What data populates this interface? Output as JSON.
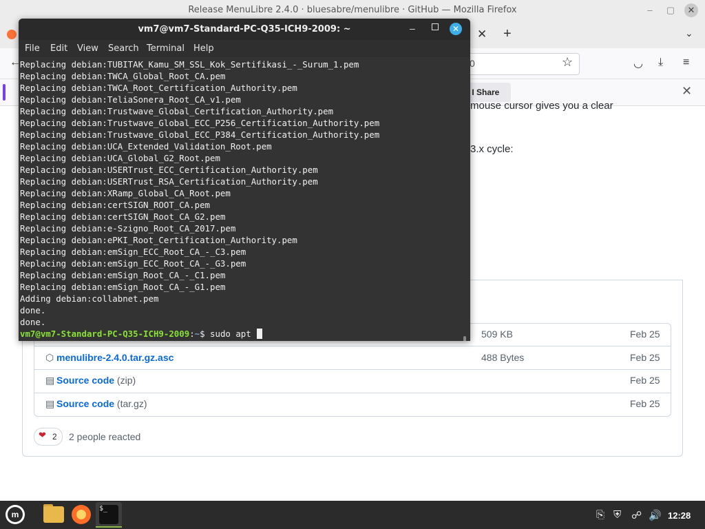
{
  "firefox": {
    "window_title": "Release MenuLibre 2.4.0 · bluesabre/menulibre · GitHub — Mozilla Firefox",
    "minimize": "–",
    "maximize": "▢",
    "close": "✕",
    "tab_close": "✕",
    "new_tab": "+",
    "tab_list": "⌄",
    "back": "←",
    "url_fragment": "0",
    "bookmark_star": "☆",
    "pocket": "◡",
    "downloads": "⤓",
    "menu": "≡",
    "notification_button": "t I Share",
    "notification_close": "✕"
  },
  "page": {
    "partial_line_1": "mouse cursor gives you a clear",
    "partial_line_2": "3.x cycle:",
    "assets": [
      {
        "icon": "⬡",
        "name": "",
        "suffix": "",
        "size": "509 KB",
        "date": "Feb 25"
      },
      {
        "icon": "⬡",
        "name": "menulibre-2.4.0.tar.gz.asc",
        "suffix": "",
        "size": "488 Bytes",
        "date": "Feb 25"
      },
      {
        "icon": "▤",
        "name": "Source code",
        "suffix": " (zip)",
        "size": "",
        "date": "Feb 25"
      },
      {
        "icon": "▤",
        "name": "Source code",
        "suffix": " (tar.gz)",
        "size": "",
        "date": "Feb 25"
      }
    ],
    "reaction_emoji": "❤",
    "reaction_count": "2",
    "reaction_text": "2 people reacted"
  },
  "terminal": {
    "title": "vm7@vm7-Standard-PC-Q35-ICH9-2009: ~",
    "minimize": "–",
    "close": "✕",
    "menu": [
      "File",
      "Edit",
      "View",
      "Search",
      "Terminal",
      "Help"
    ],
    "lines": [
      "Replacing debian:TUBITAK_Kamu_SM_SSL_Kok_Sertifikasi_-_Surum_1.pem",
      "Replacing debian:TWCA_Global_Root_CA.pem",
      "Replacing debian:TWCA_Root_Certification_Authority.pem",
      "Replacing debian:TeliaSonera_Root_CA_v1.pem",
      "Replacing debian:Trustwave_Global_Certification_Authority.pem",
      "Replacing debian:Trustwave_Global_ECC_P256_Certification_Authority.pem",
      "Replacing debian:Trustwave_Global_ECC_P384_Certification_Authority.pem",
      "Replacing debian:UCA_Extended_Validation_Root.pem",
      "Replacing debian:UCA_Global_G2_Root.pem",
      "Replacing debian:USERTrust_ECC_Certification_Authority.pem",
      "Replacing debian:USERTrust_RSA_Certification_Authority.pem",
      "Replacing debian:XRamp_Global_CA_Root.pem",
      "Replacing debian:certSIGN_ROOT_CA.pem",
      "Replacing debian:certSIGN_Root_CA_G2.pem",
      "Replacing debian:e-Szigno_Root_CA_2017.pem",
      "Replacing debian:ePKI_Root_Certification_Authority.pem",
      "Replacing debian:emSign_ECC_Root_CA_-_C3.pem",
      "Replacing debian:emSign_ECC_Root_CA_-_G3.pem",
      "Replacing debian:emSign_Root_CA_-_C1.pem",
      "Replacing debian:emSign_Root_CA_-_G1.pem",
      "Adding debian:collabnet.pem",
      "done.",
      "done."
    ],
    "prompt_user": "vm7@vm7-Standard-PC-Q35-ICH9-2009",
    "prompt_sep": ":",
    "prompt_path": "~",
    "prompt_dollar": "$ ",
    "command": "sudo apt "
  },
  "taskbar": {
    "mint_label": "m",
    "terminal_icon_text": "$_",
    "clipboard": "⎘",
    "shield": "⛨",
    "network": "☍",
    "volume": "🔊",
    "clock": "12:28"
  },
  "colors": {
    "terminal_bg": "#333333",
    "prompt_user": "#8ae234",
    "prompt_path": "#729fcf",
    "link": "#0969da",
    "close_accent": "#3daee9"
  }
}
